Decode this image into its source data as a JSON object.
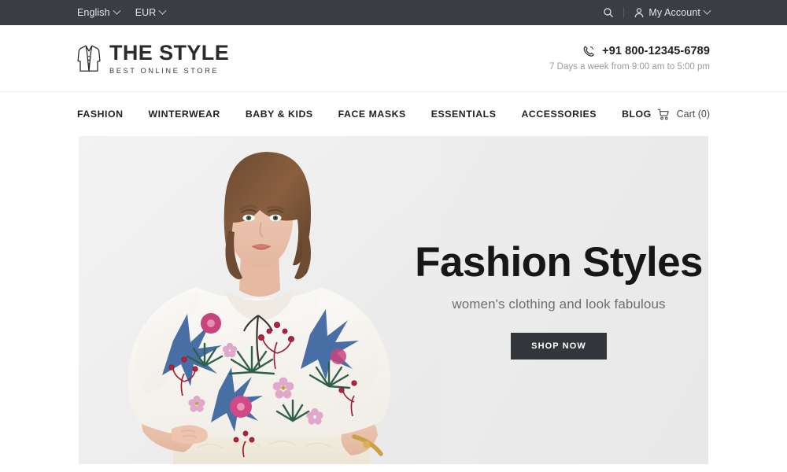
{
  "topbar": {
    "language": {
      "label": "English",
      "icon": "chevron-down-icon"
    },
    "currency": {
      "label": "EUR",
      "icon": "chevron-down-icon"
    },
    "search_icon": "search-icon",
    "account": {
      "label": "My Account",
      "icon": "user-icon",
      "chevron": "chevron-down-icon"
    }
  },
  "header": {
    "logo": {
      "icon": "coat-icon",
      "title": "THE STYLE",
      "tagline": "BEST ONLINE STORE"
    },
    "contact": {
      "icon": "phone-icon",
      "phone": "+91 800-12345-6789",
      "hours": "7 Days a week from 9:00 am to 5:00 pm"
    }
  },
  "nav": {
    "items": [
      {
        "label": "FASHION"
      },
      {
        "label": "WINTERWEAR"
      },
      {
        "label": "BABY & KIDS"
      },
      {
        "label": "FACE MASKS"
      },
      {
        "label": "ESSENTIALS"
      },
      {
        "label": "ACCESSORIES"
      },
      {
        "label": "BLOG"
      }
    ],
    "cart": {
      "icon": "cart-icon",
      "label": "Cart (0)"
    }
  },
  "hero": {
    "title": "Fashion Styles",
    "subtitle": "women's clothing and look fabulous",
    "cta_label": "SHOP NOW",
    "image_alt": "woman in white floral print blouse"
  },
  "colors": {
    "topbar_bg": "#3a3e44",
    "text_dark": "#222222",
    "muted": "#9a9a9a",
    "hero_bg": "#ececec",
    "button_bg": "#33373c"
  }
}
